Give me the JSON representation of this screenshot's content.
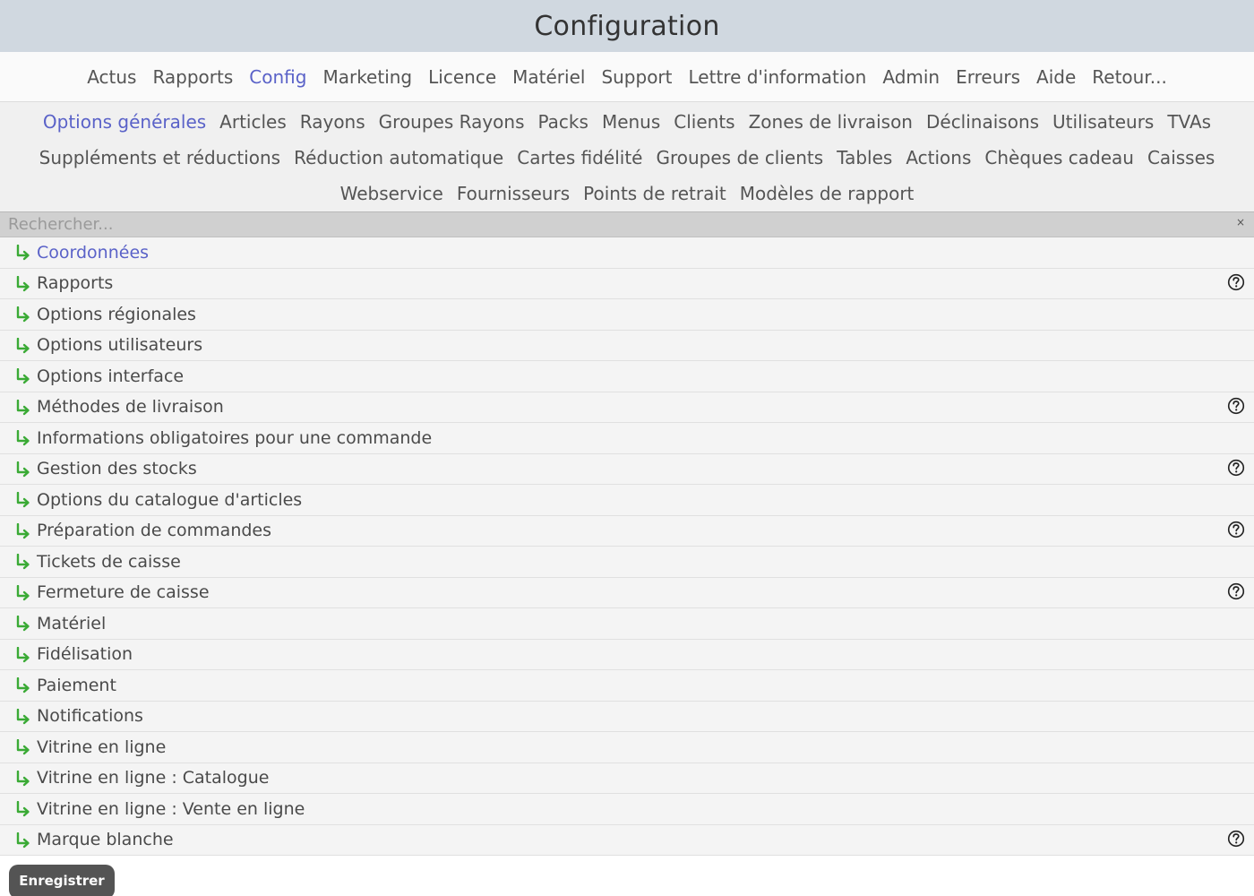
{
  "window": {
    "title": "Configuration"
  },
  "main_nav": [
    {
      "label": "Actus",
      "active": false
    },
    {
      "label": "Rapports",
      "active": false
    },
    {
      "label": "Config",
      "active": true
    },
    {
      "label": "Marketing",
      "active": false
    },
    {
      "label": "Licence",
      "active": false
    },
    {
      "label": "Matériel",
      "active": false
    },
    {
      "label": "Support",
      "active": false
    },
    {
      "label": "Lettre d'information",
      "active": false
    },
    {
      "label": "Admin",
      "active": false
    },
    {
      "label": "Erreurs",
      "active": false
    },
    {
      "label": "Aide",
      "active": false
    },
    {
      "label": "Retour...",
      "active": false
    }
  ],
  "sub_nav": [
    [
      {
        "label": "Options générales",
        "active": true
      },
      {
        "label": "Articles",
        "active": false
      },
      {
        "label": "Rayons",
        "active": false
      },
      {
        "label": "Groupes Rayons",
        "active": false
      },
      {
        "label": "Packs",
        "active": false
      },
      {
        "label": "Menus",
        "active": false
      },
      {
        "label": "Clients",
        "active": false
      },
      {
        "label": "Zones de livraison",
        "active": false
      },
      {
        "label": "Déclinaisons",
        "active": false
      },
      {
        "label": "Utilisateurs",
        "active": false
      },
      {
        "label": "TVAs",
        "active": false
      }
    ],
    [
      {
        "label": "Suppléments et réductions",
        "active": false
      },
      {
        "label": "Réduction automatique",
        "active": false
      },
      {
        "label": "Cartes fidélité",
        "active": false
      },
      {
        "label": "Groupes de clients",
        "active": false
      },
      {
        "label": "Tables",
        "active": false
      },
      {
        "label": "Actions",
        "active": false
      },
      {
        "label": "Chèques cadeau",
        "active": false
      },
      {
        "label": "Caisses",
        "active": false
      }
    ],
    [
      {
        "label": "Webservice",
        "active": false
      },
      {
        "label": "Fournisseurs",
        "active": false
      },
      {
        "label": "Points de retrait",
        "active": false
      },
      {
        "label": "Modèles de rapport",
        "active": false
      }
    ]
  ],
  "search": {
    "placeholder": "Rechercher...",
    "value": "",
    "clear_label": "×"
  },
  "settings_sections": [
    {
      "label": "Coordonnées",
      "active": true,
      "help": false
    },
    {
      "label": "Rapports",
      "active": false,
      "help": true
    },
    {
      "label": "Options régionales",
      "active": false,
      "help": false
    },
    {
      "label": "Options utilisateurs",
      "active": false,
      "help": false
    },
    {
      "label": "Options interface",
      "active": false,
      "help": false
    },
    {
      "label": "Méthodes de livraison",
      "active": false,
      "help": true
    },
    {
      "label": "Informations obligatoires pour une commande",
      "active": false,
      "help": false
    },
    {
      "label": "Gestion des stocks",
      "active": false,
      "help": true
    },
    {
      "label": "Options du catalogue d'articles",
      "active": false,
      "help": false
    },
    {
      "label": "Préparation de commandes",
      "active": false,
      "help": true
    },
    {
      "label": "Tickets de caisse",
      "active": false,
      "help": false
    },
    {
      "label": "Fermeture de caisse",
      "active": false,
      "help": true
    },
    {
      "label": "Matériel",
      "active": false,
      "help": false
    },
    {
      "label": "Fidélisation",
      "active": false,
      "help": false
    },
    {
      "label": "Paiement",
      "active": false,
      "help": false
    },
    {
      "label": "Notifications",
      "active": false,
      "help": false
    },
    {
      "label": "Vitrine en ligne",
      "active": false,
      "help": false
    },
    {
      "label": "Vitrine en ligne : Catalogue",
      "active": false,
      "help": false
    },
    {
      "label": "Vitrine en ligne : Vente en ligne",
      "active": false,
      "help": false
    },
    {
      "label": "Marque blanche",
      "active": false,
      "help": true
    }
  ],
  "save_button": {
    "label": "Enregistrer"
  },
  "icons": {
    "row_arrow": "return-arrow-icon",
    "help": "help-circle-icon",
    "clear": "close-icon"
  },
  "colors": {
    "accent": "#5a62c8",
    "arrow": "#3aaa35",
    "title_bar": "#d0d8e0",
    "button": "#545454"
  }
}
